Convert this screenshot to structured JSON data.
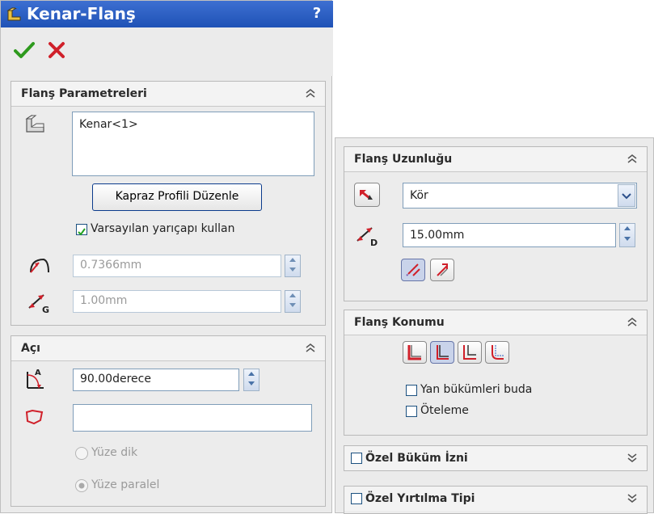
{
  "left_panel": {
    "title": "Kenar-Flanş",
    "help_label": "?",
    "ok_icon": "check-icon",
    "cancel_icon": "x-icon",
    "flange_params": {
      "header": "Flanş Parametreleri",
      "edge_list_value": "Kenar<1>",
      "edit_profile_button": "Kapraz Profili Düzenle",
      "use_default_radius_label": "Varsayılan yarıçapı kullan",
      "use_default_radius_checked": true,
      "radius_value": "0.7366mm",
      "gap_value": "1.00mm"
    },
    "angle": {
      "header": "Açı",
      "angle_value": "90.00derece",
      "face_value": "",
      "perp_label": "Yüze dik",
      "parallel_label": "Yüze paralel",
      "selected": "parallel"
    }
  },
  "right_panel": {
    "flange_length": {
      "header": "Flanş Uzunluğu",
      "end_condition": "Kör",
      "length_value": "15.00mm"
    },
    "flange_position": {
      "header": "Flanş Konumu",
      "trim_side_bends_label": "Yan bükümleri buda",
      "trim_side_bends_checked": false,
      "offset_label": "Öteleme",
      "offset_checked": false
    },
    "custom_bend_allowance": {
      "header": "Özel Büküm İzni",
      "checked": false
    },
    "custom_relief_type": {
      "header": "Özel Yırtılma Tipi",
      "checked": false
    }
  },
  "colors": {
    "title_bar": "#2a5fc4",
    "panel_bg": "#ebebeb",
    "accent_red": "#d0202a",
    "ok_green": "#2e9a1e"
  }
}
